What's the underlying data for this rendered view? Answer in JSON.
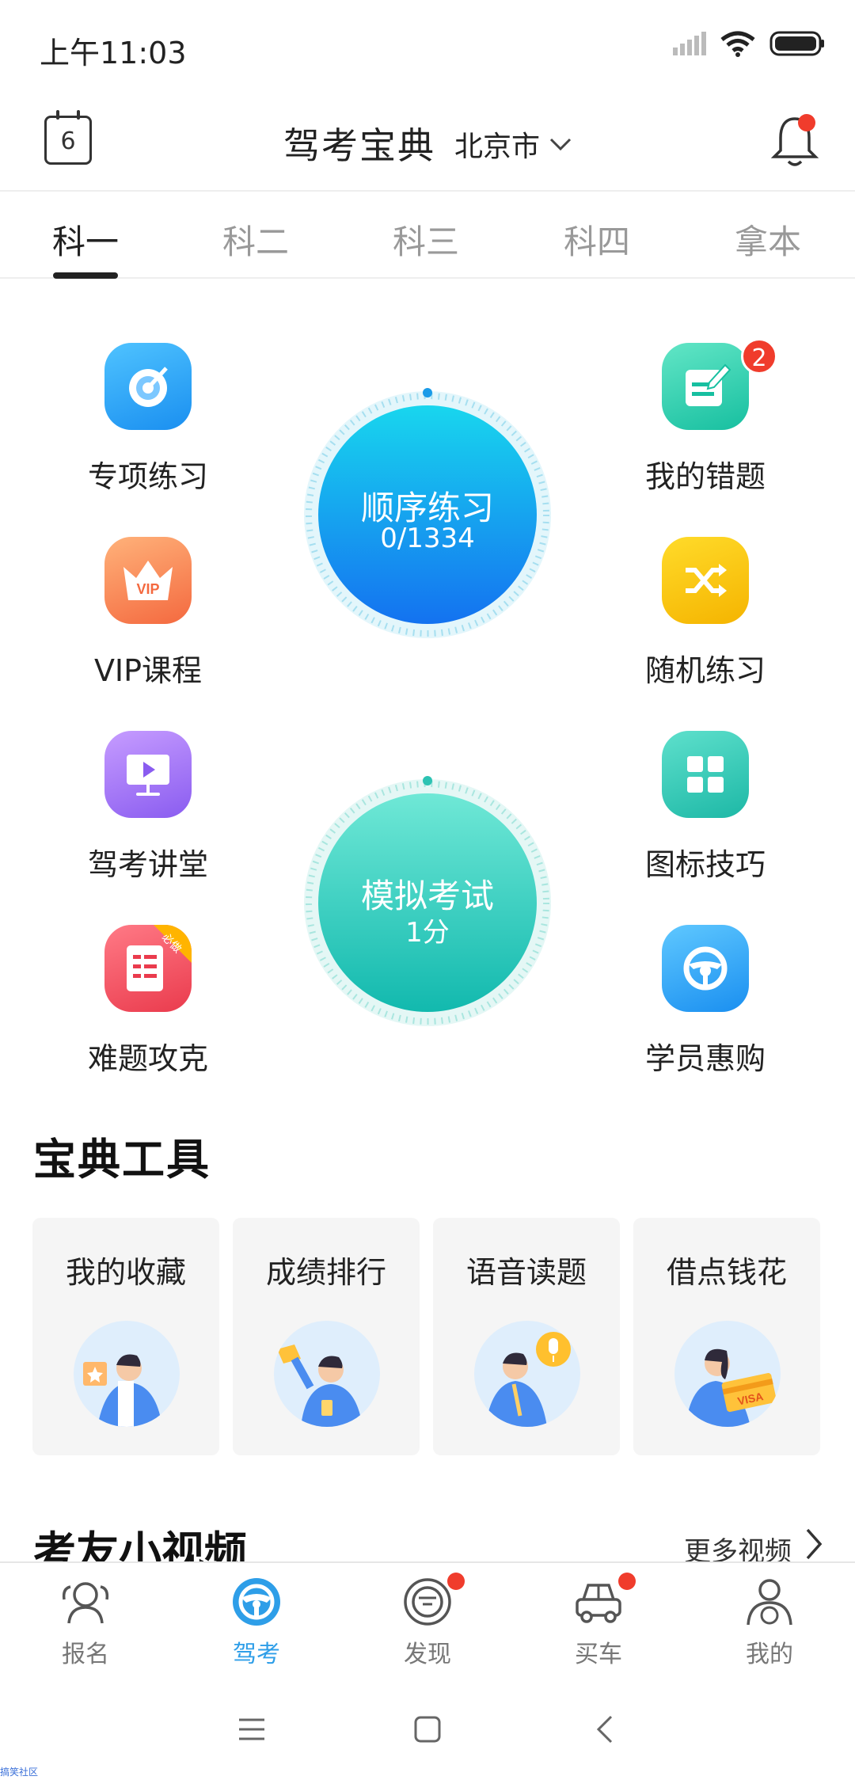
{
  "status_bar": {
    "time": "上午11:03"
  },
  "header": {
    "calendar_day": "6",
    "title": "驾考宝典",
    "city": "北京市"
  },
  "tabs": [
    {
      "label": "科一",
      "active": true
    },
    {
      "label": "科二",
      "active": false
    },
    {
      "label": "科三",
      "active": false
    },
    {
      "label": "科四",
      "active": false
    },
    {
      "label": "拿本",
      "active": false
    }
  ],
  "features": {
    "left": [
      {
        "label": "专项练习",
        "icon": "target-icon"
      },
      {
        "label": "VIP课程",
        "icon": "vip-crown-icon"
      },
      {
        "label": "驾考讲堂",
        "icon": "video-lecture-icon"
      },
      {
        "label": "难题攻克",
        "icon": "hard-question-icon",
        "tag": "必做"
      }
    ],
    "right": [
      {
        "label": "我的错题",
        "icon": "wrong-questions-icon",
        "badge": "2"
      },
      {
        "label": "随机练习",
        "icon": "shuffle-icon"
      },
      {
        "label": "图标技巧",
        "icon": "icon-tips-grid-icon"
      },
      {
        "label": "学员惠购",
        "icon": "steering-wheel-icon"
      }
    ],
    "sequential": {
      "title": "顺序练习",
      "progress": "0/1334"
    },
    "mock_exam": {
      "title": "模拟考试",
      "score": "1分"
    },
    "vip_text": "VIP"
  },
  "tools": {
    "title": "宝典工具",
    "items": [
      {
        "label": "我的收藏"
      },
      {
        "label": "成绩排行"
      },
      {
        "label": "语音读题"
      },
      {
        "label": "借点钱花",
        "card_text": "VISA"
      }
    ]
  },
  "videos": {
    "title": "考友小视频",
    "more": "更多视频"
  },
  "bottom_nav": [
    {
      "label": "报名",
      "icon": "signup-icon",
      "active": false,
      "dot": false
    },
    {
      "label": "驾考",
      "icon": "steering-wheel-icon",
      "active": true,
      "dot": false
    },
    {
      "label": "发现",
      "icon": "discover-icon",
      "active": false,
      "dot": true
    },
    {
      "label": "买车",
      "icon": "car-icon",
      "active": false,
      "dot": true
    },
    {
      "label": "我的",
      "icon": "profile-icon",
      "active": false,
      "dot": false
    }
  ],
  "watermark": "搞笑社区",
  "colors": {
    "accent_blue": "#2e9ee8",
    "badge_red": "#f03c2c",
    "sequential_blue": "#1a8ff0",
    "mock_teal": "#22c7b8"
  }
}
